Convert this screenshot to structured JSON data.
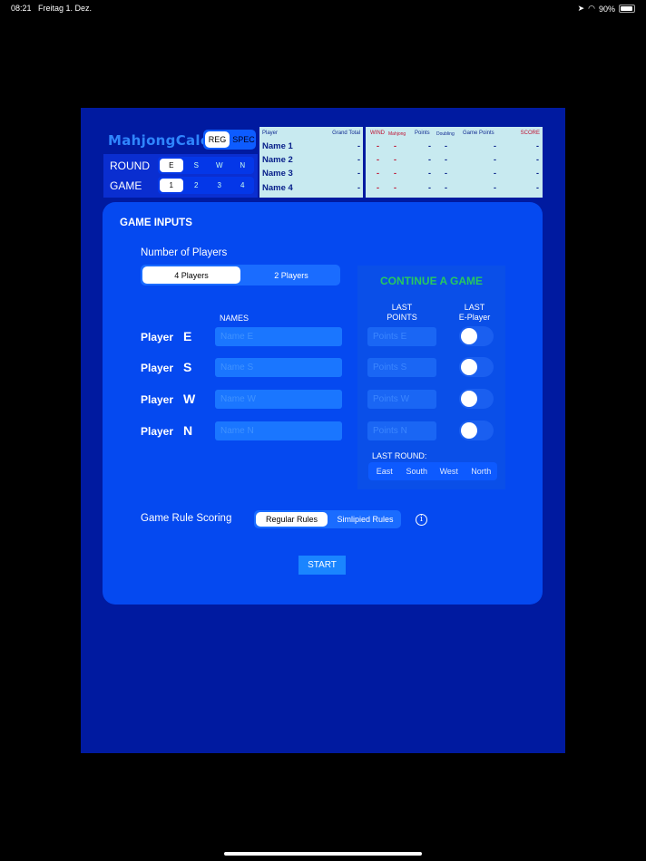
{
  "status": {
    "time": "08:21",
    "date": "Freitag 1. Dez.",
    "battery": "90%"
  },
  "header": {
    "logo": "MahjongCalc",
    "mode_options": [
      "REG",
      "SPEC"
    ],
    "round_label": "ROUND",
    "round_options": [
      "E",
      "S",
      "W",
      "N"
    ],
    "game_label": "GAME",
    "game_options": [
      "1",
      "2",
      "3",
      "4"
    ]
  },
  "scoreboard": {
    "headers": {
      "player": "Player",
      "grand_total": "Grand Total",
      "wind": "WIND",
      "mahjong": "Mahjong",
      "points": "Points",
      "doubling": "Doubling",
      "game_points": "Game Points",
      "score": "SCORE"
    },
    "names": [
      "Name 1",
      "Name 2",
      "Name 3",
      "Name 4"
    ],
    "dash": "-"
  },
  "panel": {
    "title": "GAME INPUTS",
    "num_players_label": "Number of Players",
    "player_options": [
      "4 Players",
      "2 Players"
    ],
    "names_label": "NAMES",
    "player_word": "Player",
    "winds": [
      "E",
      "S",
      "W",
      "N"
    ],
    "name_placeholders": [
      "Name E",
      "Name S",
      "Name W",
      "Name N"
    ],
    "continue": {
      "title": "CONTINUE A GAME",
      "last_points_label": "LAST\nPOINTS",
      "last_eplayer_label": "LAST\nE-Player",
      "points_placeholders": [
        "Points E",
        "Points S",
        "Points W",
        "Points N"
      ],
      "last_round_label": "LAST ROUND:",
      "round_options": [
        "East",
        "South",
        "West",
        "North"
      ]
    },
    "rule_label": "Game Rule Scoring",
    "rule_options": [
      "Regular Rules",
      "Simlipied Rules"
    ],
    "info_icon": "i",
    "start_label": "START"
  }
}
